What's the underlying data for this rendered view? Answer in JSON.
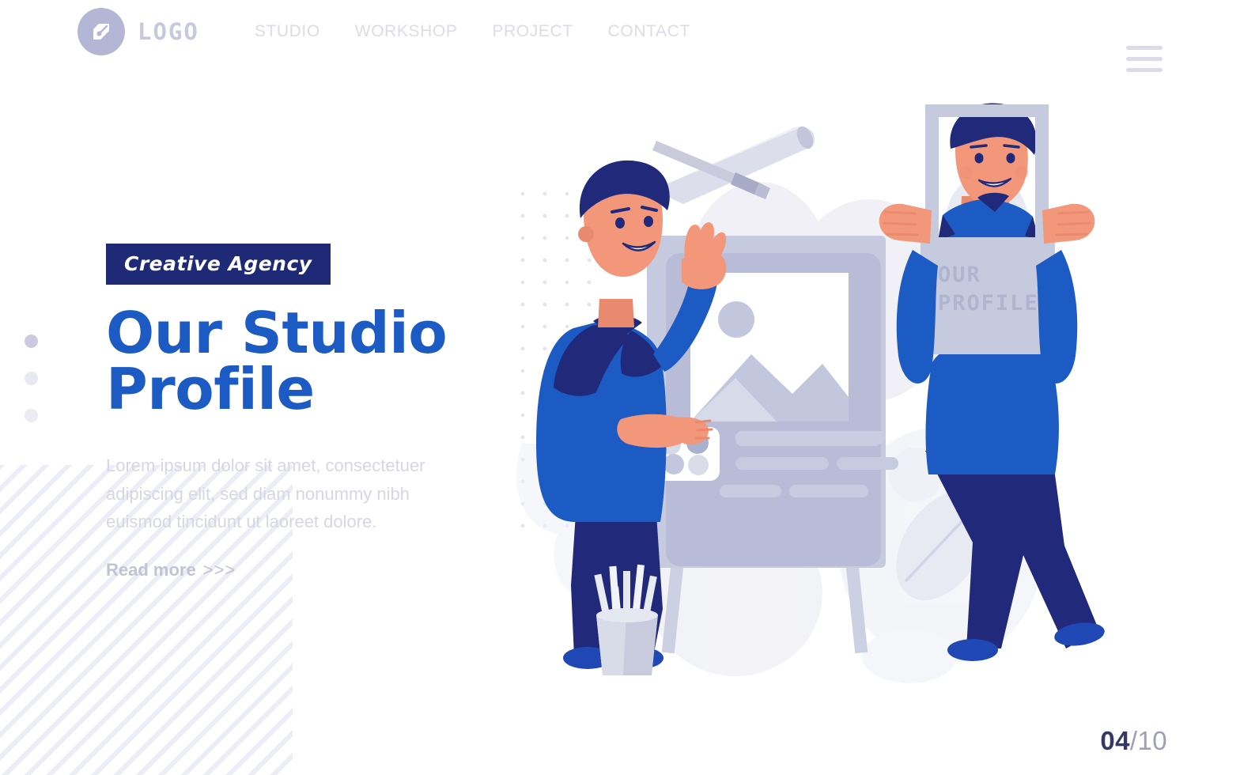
{
  "header": {
    "logo": {
      "icon": "pen-nib-icon",
      "text": "LOGO"
    },
    "nav": [
      {
        "label": "STUDIO"
      },
      {
        "label": "WORKSHOP"
      },
      {
        "label": "PROJECT"
      },
      {
        "label": "CONTACT"
      }
    ],
    "menu_icon": "hamburger-menu-icon"
  },
  "hero": {
    "badge": "Creative Agency",
    "headline_line1": "Our Studio",
    "headline_line2": "Profile",
    "body": "Lorem ipsum dolor sit amet, consectetuer adipiscing elit, sed diam nonummy nibh euismod tincidunt ut laoreet dolore.",
    "read_more": "Read more",
    "read_more_chevrons": ">>>"
  },
  "pagination": {
    "current": "04",
    "separator": "/",
    "total": "10"
  },
  "illustration": {
    "placard_line1": "OUR",
    "placard_line2": "PROFILE"
  },
  "colors": {
    "primary_blue": "#1d5bc4",
    "deep_navy": "#1f2a77",
    "badge_bg": "#1f2a77",
    "muted_text": "#d6d7e2",
    "logo_purple": "#b5b5d6",
    "pagination_dark": "#343a63",
    "illustration_grey": "#b9bdd6",
    "skin": "#f2977a"
  }
}
